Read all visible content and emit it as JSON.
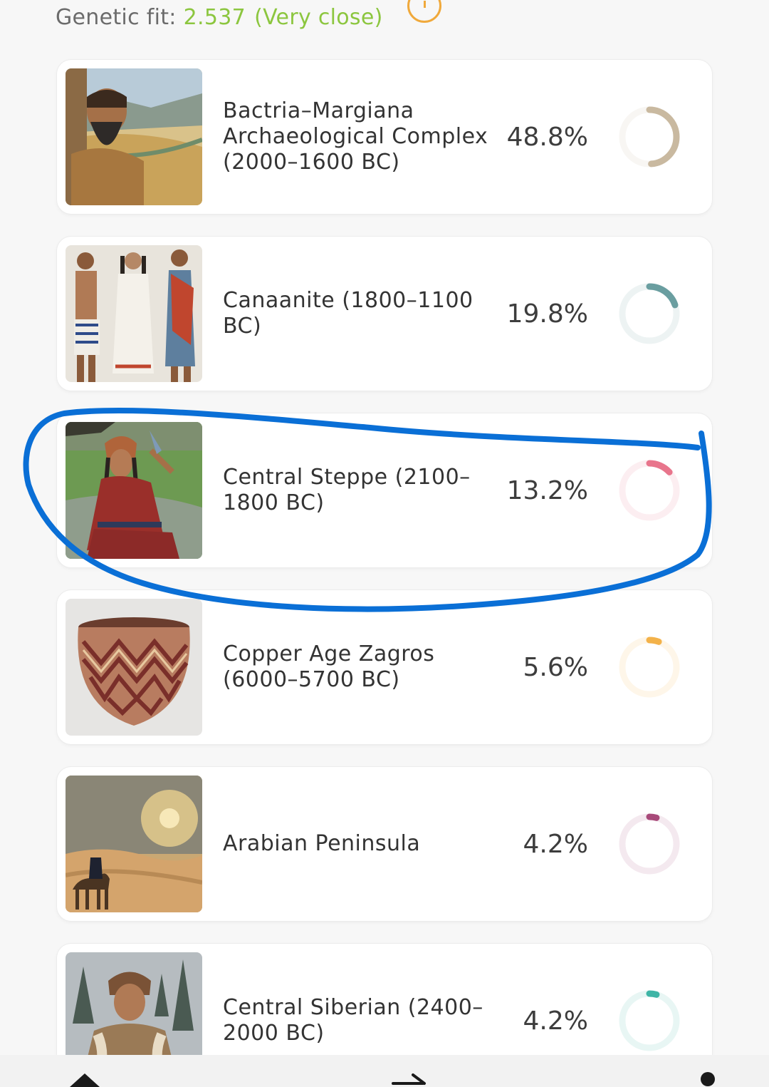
{
  "header": {
    "fit_label": "Genetic fit:",
    "fit_value": "2.537",
    "fit_desc": "(Very close)",
    "info_icon": "info-circle-icon",
    "accent_color": "#8cc63f"
  },
  "populations": [
    {
      "name": "Bactria–Margiana Archaeological Complex (2000–1600 BC)",
      "percent_label": "48.8%",
      "percent": 48.8,
      "color": "#c9b9a0",
      "image": "bearded-man-landscape-image"
    },
    {
      "name": "Canaanite (1800–1100 BC)",
      "percent_label": "19.8%",
      "percent": 19.8,
      "color": "#6a9ea0",
      "image": "three-ancient-figures-image"
    },
    {
      "name": "Central Steppe (2100–1800 BC)",
      "percent_label": "13.2%",
      "percent": 13.2,
      "color": "#e8758c",
      "image": "steppe-woman-image",
      "highlighted": true
    },
    {
      "name": "Copper Age Zagros (6000–5700 BC)",
      "percent_label": "5.6%",
      "percent": 5.6,
      "color": "#f3b24a",
      "image": "painted-pottery-image"
    },
    {
      "name": "Arabian Peninsula",
      "percent_label": "4.2%",
      "percent": 4.2,
      "color": "#a84a7a",
      "image": "desert-camel-image"
    },
    {
      "name": "Central Siberian (2400–2000 BC)",
      "percent_label": "4.2%",
      "percent": 4.2,
      "color": "#3fb5a6",
      "image": "siberian-person-forest-image"
    }
  ],
  "annotation": {
    "color": "#0a6fd6",
    "shape": "hand-drawn-ellipse"
  },
  "nav": {
    "home_icon": "home-triangle-icon",
    "share_icon": "arrow-right-icon",
    "menu_icon": "dot-icon"
  }
}
